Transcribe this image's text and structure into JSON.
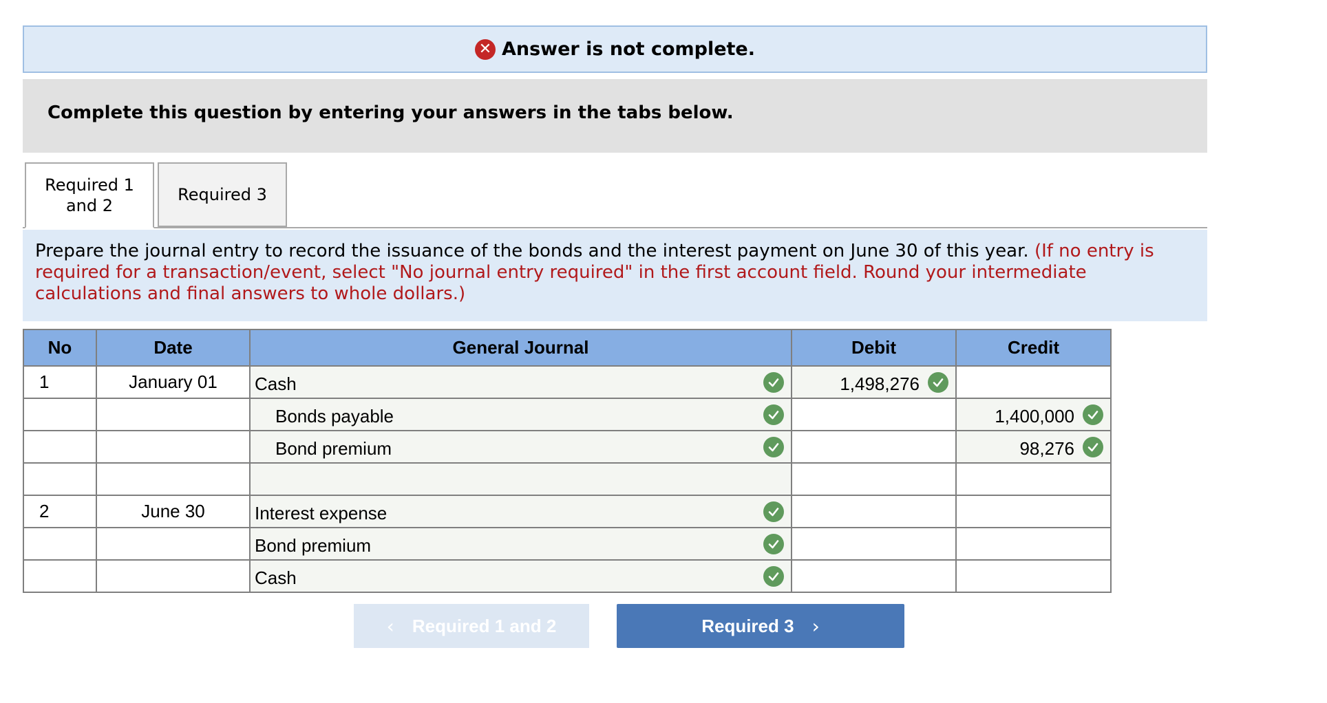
{
  "status": {
    "icon": "close-icon",
    "message": "Answer is not complete."
  },
  "instruction": "Complete this question by entering your answers in the tabs below.",
  "tabs": [
    {
      "label": "Required 1 and 2",
      "line1": "Required 1",
      "line2": "and 2",
      "active": true
    },
    {
      "label": "Required 3",
      "active": false
    }
  ],
  "question": {
    "text": "Prepare the journal entry to record the issuance of the bonds and the interest payment on June 30 of this year.",
    "note": "(If no entry is required for a transaction/event, select \"No journal entry required\" in the first account field. Round your intermediate calculations and final answers to whole dollars.)"
  },
  "journal": {
    "headers": {
      "no": "No",
      "date": "Date",
      "account": "General Journal",
      "debit": "Debit",
      "credit": "Credit"
    },
    "rows": [
      {
        "no": "1",
        "date": "January 01",
        "account": "Cash",
        "debit": "1,498,276",
        "credit": ""
      },
      {
        "no": "",
        "date": "",
        "account": "Bonds payable",
        "debit": "",
        "credit": "1,400,000"
      },
      {
        "no": "",
        "date": "",
        "account": "Bond premium",
        "debit": "",
        "credit": "98,276"
      },
      {
        "no": "",
        "date": "",
        "account": "",
        "debit": "",
        "credit": ""
      },
      {
        "no": "2",
        "date": "June 30",
        "account": "Interest expense",
        "debit": "",
        "credit": ""
      },
      {
        "no": "",
        "date": "",
        "account": "Bond premium",
        "debit": "",
        "credit": ""
      },
      {
        "no": "",
        "date": "",
        "account": "Cash",
        "debit": "",
        "credit": ""
      }
    ]
  },
  "nav": {
    "prev_label": "Required 1 and 2",
    "next_label": "Required 3",
    "prev_icon": "chevron-left-icon",
    "next_icon": "chevron-right-icon",
    "prev_glyph": "‹",
    "next_glyph": "›"
  },
  "colors": {
    "error": "#c42726",
    "check": "#5f9a5c",
    "header": "#86aee3",
    "note": "#b1191b",
    "next_button": "#4a78b7"
  }
}
